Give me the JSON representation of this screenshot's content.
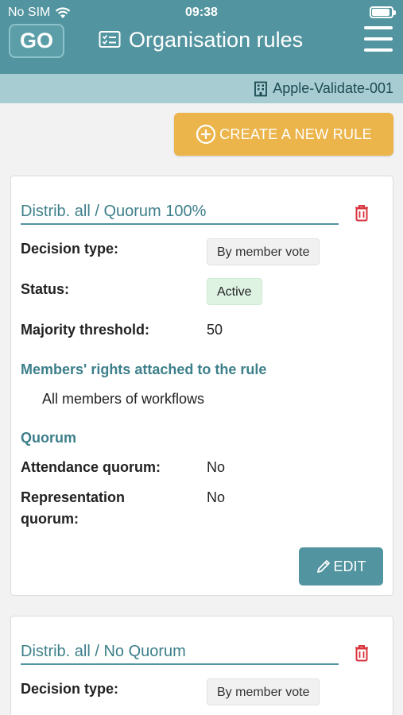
{
  "status_bar": {
    "carrier": "No SIM",
    "time": "09:38"
  },
  "header": {
    "logo_text": "GO",
    "title": "Organisation rules"
  },
  "org_bar": {
    "org_name": "Apple-Validate-001"
  },
  "actions": {
    "create_label": "CREATE A NEW RULE"
  },
  "labels": {
    "decision_type": "Decision type:",
    "status": "Status:",
    "majority_threshold": "Majority threshold:",
    "members_rights": "Members' rights attached to the rule",
    "quorum": "Quorum",
    "attendance_quorum": "Attendance quorum:",
    "representation_quorum_1": "Representation",
    "representation_quorum_2": "quorum:",
    "edit": "EDIT"
  },
  "rules": [
    {
      "name": "Distrib. all / Quorum 100%",
      "decision_type": "By member vote",
      "status": "Active",
      "majority_threshold": "50",
      "members_rights": "All members of workflows",
      "attendance_quorum": "No",
      "representation_quorum": "No"
    },
    {
      "name": "Distrib. all / No Quorum",
      "decision_type": "By member vote"
    }
  ],
  "colors": {
    "primary": "#52949f",
    "accent": "#ecb54c",
    "danger": "#d9363e",
    "status_active_bg": "#dff3e3"
  },
  "icons": [
    "wifi-icon",
    "battery-icon",
    "checklist-icon",
    "menu-icon",
    "building-icon",
    "plus-circle-icon",
    "trash-icon",
    "pencil-icon"
  ]
}
